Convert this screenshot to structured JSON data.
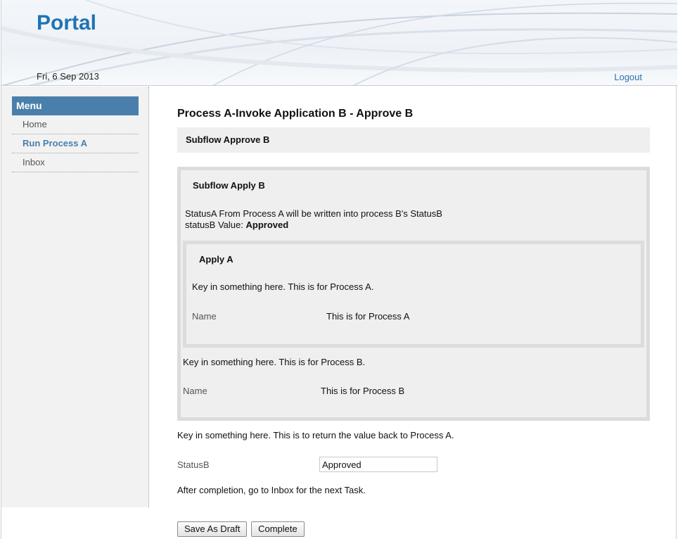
{
  "header": {
    "brand": "Portal",
    "date": "Fri, 6 Sep 2013",
    "logout_label": "Logout"
  },
  "sidebar": {
    "title": "Menu",
    "items": [
      {
        "label": "Home",
        "active": false
      },
      {
        "label": "Run Process A",
        "active": true
      },
      {
        "label": "Inbox",
        "active": false
      }
    ]
  },
  "main": {
    "page_title": "Process A-Invoke Application B - Approve B",
    "section_title": "Subflow Approve B",
    "outer": {
      "title": "Subflow Apply B",
      "desc_line1": "StatusA From Process A will be written into process B's StatusB",
      "status_label": "statusB Value: ",
      "status_value": "Approved",
      "inner": {
        "title": "Apply A",
        "instruction": "Key in something here. This is for Process A.",
        "name_label": "Name",
        "name_value": "This is for Process A"
      },
      "instruction": "Key in something here. This is for Process B.",
      "name_label": "Name",
      "name_value": "This is for Process B"
    },
    "return_instruction": "Key in something here. This is to return the value back to Process A.",
    "status_field": {
      "label": "StatusB",
      "value": "Approved"
    },
    "completion_note": "After completion, go to Inbox for the next Task.",
    "buttons": {
      "save_draft": "Save As Draft",
      "complete": "Complete"
    }
  }
}
